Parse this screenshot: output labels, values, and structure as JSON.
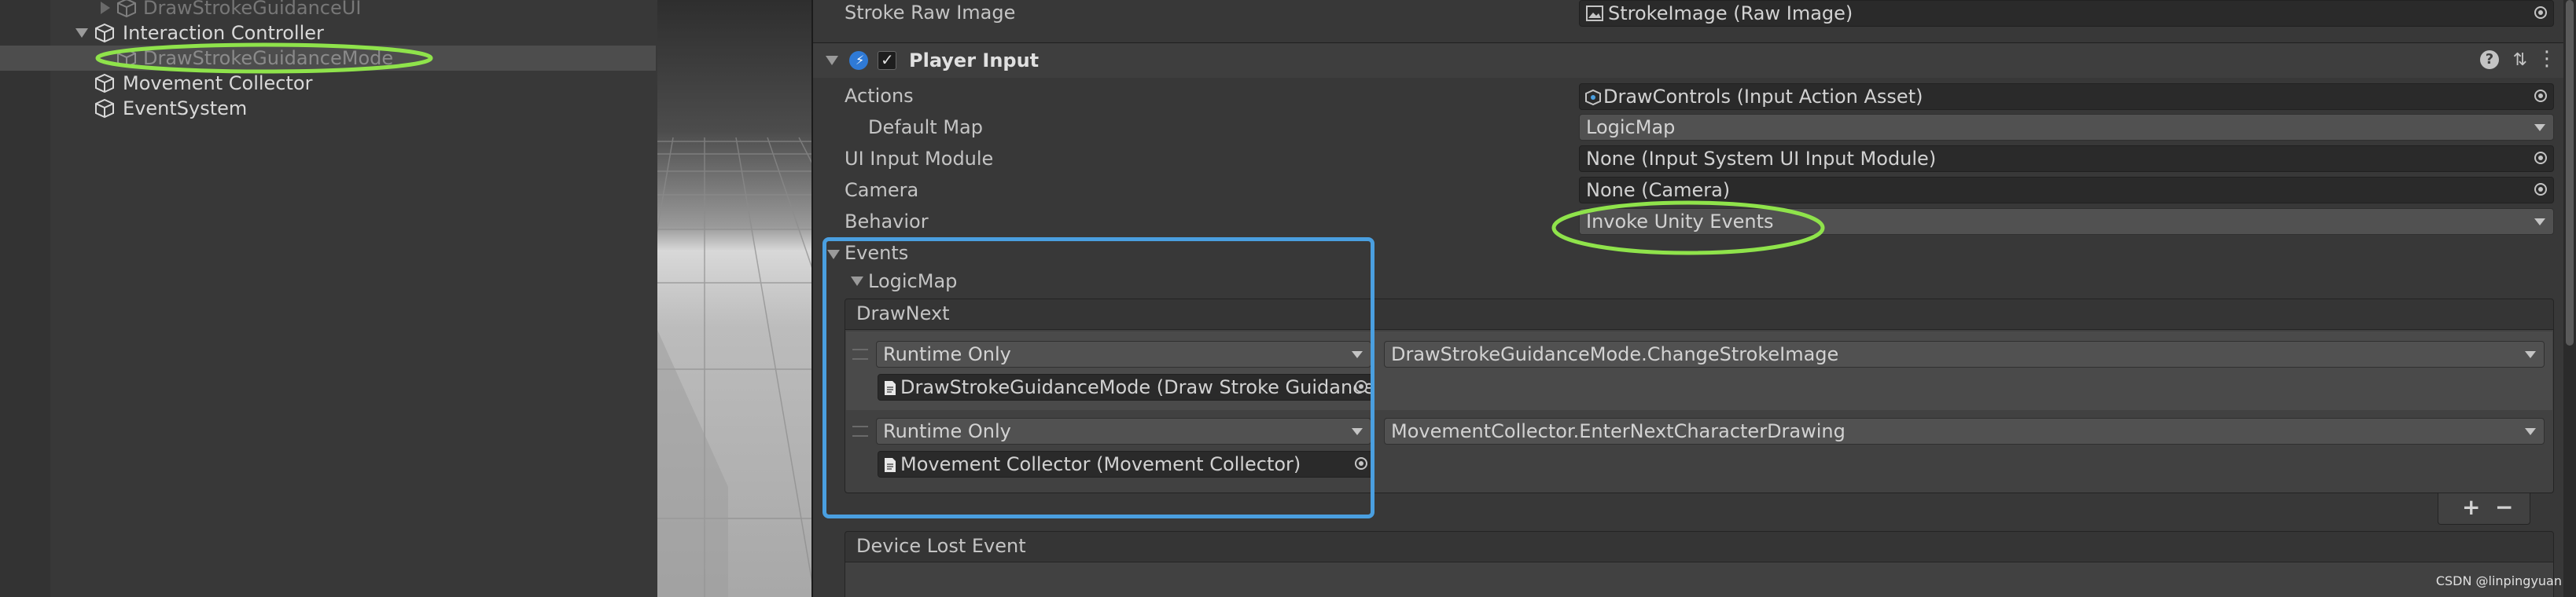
{
  "hierarchy": {
    "items": [
      {
        "label": "DrawStrokeGuidanceUI"
      },
      {
        "label": "Interaction Controller"
      },
      {
        "label": "DrawStrokeGuidanceMode"
      },
      {
        "label": "Movement Collector"
      },
      {
        "label": "EventSystem"
      }
    ]
  },
  "inspector": {
    "stroke_raw_image": {
      "label": "Stroke Raw Image",
      "value": "StrokeImage (Raw Image)"
    },
    "component": {
      "title": "Player Input",
      "enabled": true
    },
    "actions": {
      "label": "Actions",
      "value": "DrawControls (Input Action Asset)"
    },
    "default_map": {
      "label": "Default Map",
      "value": "LogicMap"
    },
    "ui_input_module": {
      "label": "UI Input Module",
      "value": "None (Input System UI Input Module)"
    },
    "camera": {
      "label": "Camera",
      "value": "None (Camera)"
    },
    "behavior": {
      "label": "Behavior",
      "value": "Invoke Unity Events"
    },
    "events": {
      "label": "Events",
      "map_label": "LogicMap",
      "draw_next": {
        "title": "DrawNext",
        "listeners": [
          {
            "mode": "Runtime Only",
            "target": "DrawStrokeGuidanceMode (Draw Stroke Guidance",
            "function": "DrawStrokeGuidanceMode.ChangeStrokeImage"
          },
          {
            "mode": "Runtime Only",
            "target": "Movement Collector (Movement Collector)",
            "function": "MovementCollector.EnterNextCharacterDrawing"
          }
        ],
        "add": "+",
        "remove": "−"
      },
      "device_lost": {
        "title": "Device Lost Event"
      }
    }
  },
  "watermark": "CSDN @linpingyuan",
  "colors": {
    "highlight_green": "#8fe34b",
    "highlight_blue": "#4a9fe0",
    "panel_bg": "#383838",
    "field_bg": "#2a2a2a",
    "dropdown_bg": "#515151"
  }
}
